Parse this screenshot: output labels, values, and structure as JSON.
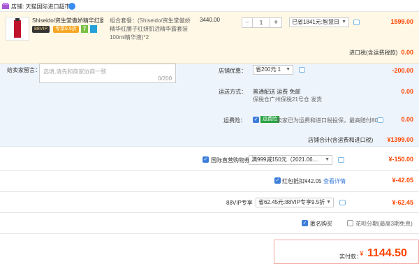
{
  "store": {
    "name": "店铺: 天猫国际进口超市"
  },
  "item": {
    "title": "Shiseido/资生堂傲娇精华红腰...",
    "badge_88vip": "88VIP",
    "badge_discount": "专享9.5折",
    "badge_7": "7",
    "combo_desc": "组合套餐：(Shiseido/资生堂傲娇精华红腰子红妍肌活精华露套装100ml精华液)*2",
    "unit_price": "3440.00",
    "quantity": "1",
    "discount_select": "已省1841元:智慧日",
    "total": "1599.00"
  },
  "import_tax": "进口税(含运费税款)",
  "import_tax_value": "0.00",
  "memo": {
    "label": "给卖家留言：",
    "placeholder": "选填,请先和商家协商一致",
    "counter": "0/200"
  },
  "shop_discount": {
    "label": "店铺优惠：",
    "select": "省200元:1",
    "value": "-200.00"
  },
  "shipping": {
    "label": "运送方式：",
    "line1": "普通配送 运费 免邮",
    "line2": "保税仓广州保税21号仓  发货",
    "value": "0.00"
  },
  "insurance": {
    "label": "运费险：",
    "tag": "运费险",
    "text": "卖家已为运费和进口税投保，最高赔付80元",
    "value": "0.00"
  },
  "store_total": {
    "label": "店铺合计(含运费和进口税)",
    "value": "¥1399.00"
  },
  "coupon": {
    "label": "国际直营购物券",
    "select": "满999减150元（2021.06....",
    "value": "¥-150.00"
  },
  "red_packet": {
    "label": "红包抵扣¥42.05",
    "link": "查看详情",
    "value": "¥-42.05"
  },
  "vip": {
    "label": "88VIP专享",
    "select": "省62.45元:88VIP专享9.5折",
    "value": "¥-62.45"
  },
  "anonymous": {
    "label": "匿名购买"
  },
  "installment": {
    "label": "花呗分期(最高3期免息)"
  },
  "payment": {
    "label": "实付款：",
    "currency": "¥",
    "value": "1144.50"
  },
  "colors": {
    "accent": "#ff4400",
    "checkbox": "#3c7dd9"
  }
}
